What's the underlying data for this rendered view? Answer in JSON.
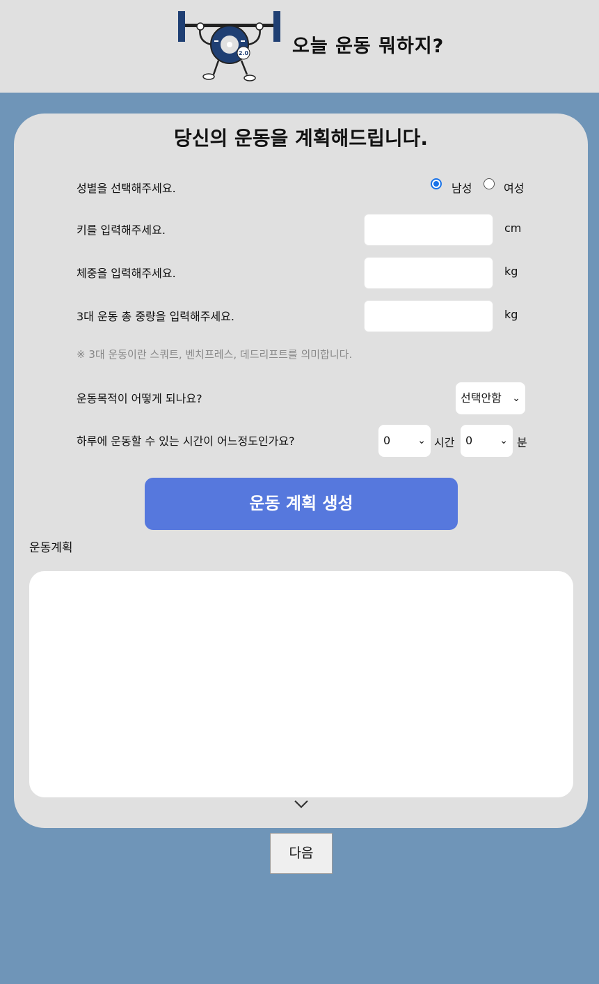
{
  "header": {
    "title": "오늘 운동 뭐하지?",
    "logo_icon": "barbell-mascot-icon",
    "logo_badge": "2.0"
  },
  "form": {
    "title": "당신의 운동을 계획해드립니다.",
    "gender": {
      "label": "성별을 선택해주세요.",
      "options": [
        "남성",
        "여성"
      ],
      "selected": "남성"
    },
    "height": {
      "label": "키를 입력해주세요.",
      "value": "",
      "unit": "cm"
    },
    "weight": {
      "label": "체중을 입력해주세요.",
      "value": "",
      "unit": "kg"
    },
    "big3": {
      "label": "3대 운동 총 중량을 입력해주세요.",
      "value": "",
      "unit": "kg"
    },
    "note": "※ 3대 운동이란 스쿼트, 벤치프레스, 데드리프트를 의미합니다.",
    "goal": {
      "label": "운동목적이 어떻게 되나요?",
      "selected": "선택안함"
    },
    "time": {
      "label": "하루에 운동할 수 있는 시간이 어느정도인가요?",
      "hours": "0",
      "hours_unit": "시간",
      "minutes": "0",
      "minutes_unit": "분"
    },
    "generate_button": "운동 계획 생성",
    "plan_label": "운동계획",
    "plan_text": "",
    "expand_icon": "chevron-down-icon"
  },
  "next_button": "다음",
  "colors": {
    "background": "#6f95b8",
    "panel": "#e0e0e0",
    "primary_button": "#5678dd",
    "radio_accent": "#1a73e8",
    "logo_blue": "#1f3f73"
  }
}
